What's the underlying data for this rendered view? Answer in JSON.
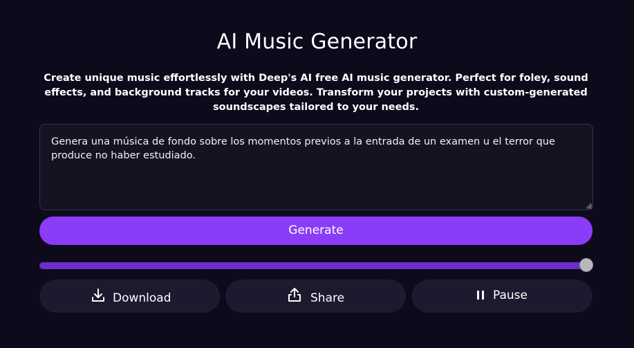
{
  "header": {
    "title": "AI Music Generator",
    "description": "Create unique music effortlessly with Deep's AI free AI music generator. Perfect for foley, sound effects, and background tracks for your videos. Transform your projects with custom-generated soundscapes tailored to your needs."
  },
  "prompt": {
    "value": "Genera una música de fondo sobre los momentos previos a la entrada de un examen u el terror que produce no haber estudiado."
  },
  "generate": {
    "label": "Generate"
  },
  "player": {
    "progress_percent": 100
  },
  "actions": {
    "download": {
      "label": "Download",
      "icon": "download-icon"
    },
    "share": {
      "label": "Share",
      "icon": "share-icon"
    },
    "pause": {
      "label": "Pause",
      "icon": "pause-icon"
    }
  },
  "colors": {
    "background": "#0d0a1c",
    "accent": "#8b3cf7",
    "progress_fill": "#6a2fc9",
    "button_bg": "#1c1a2e"
  }
}
